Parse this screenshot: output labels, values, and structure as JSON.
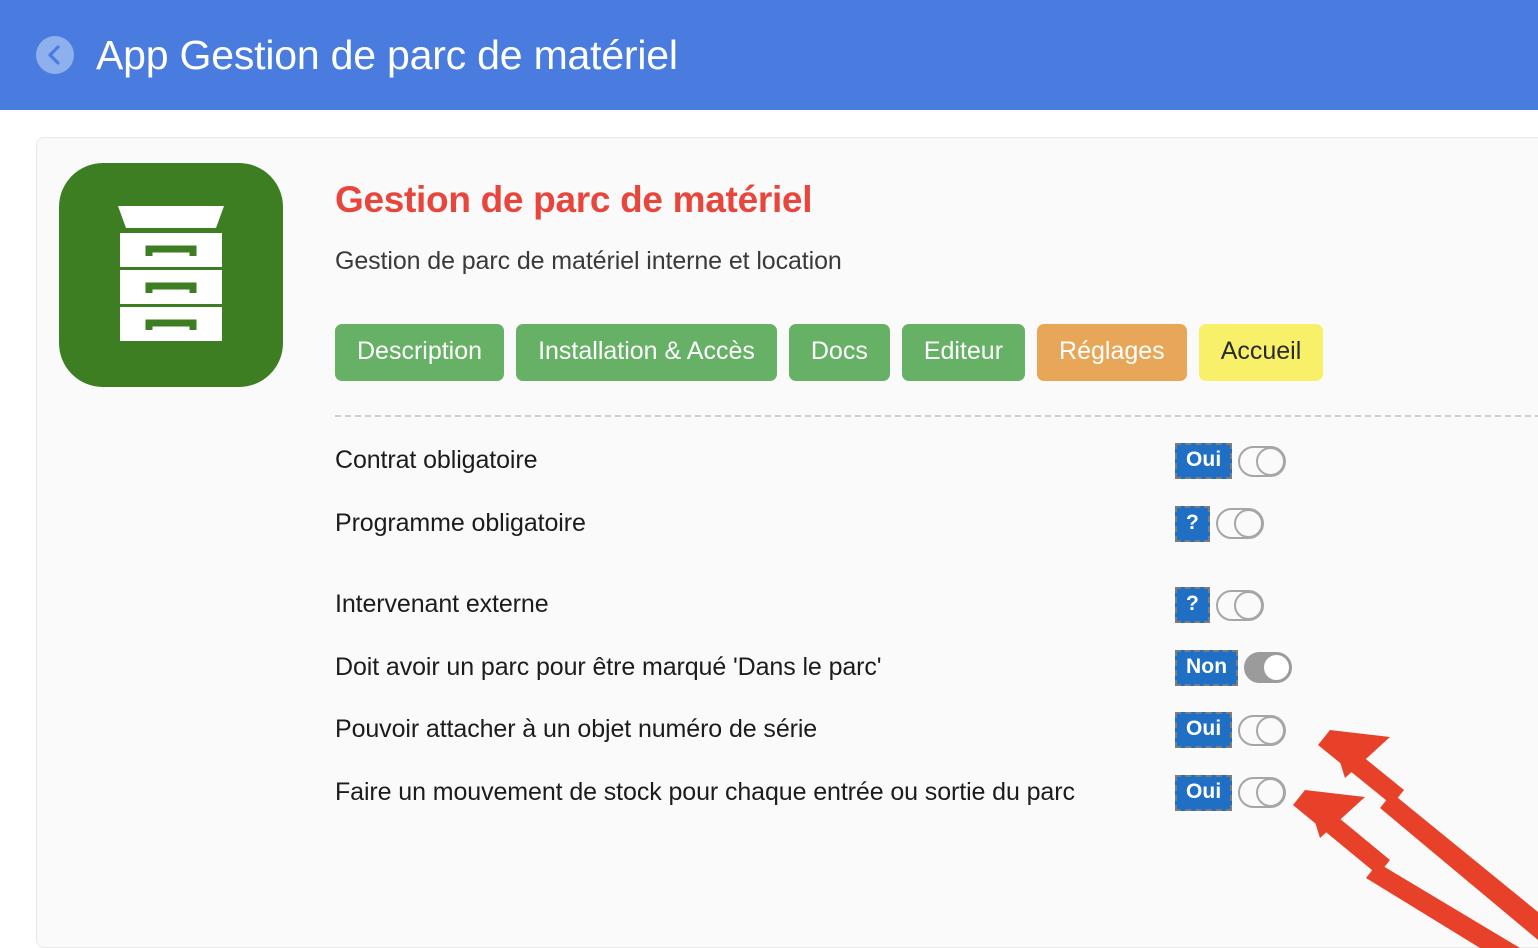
{
  "header": {
    "title": "App Gestion de parc de matériel",
    "back_icon": "chevron-left-circle-icon",
    "bg_color": "#4a7ce0"
  },
  "app": {
    "icon": "file-cabinet-icon",
    "icon_bg_color": "#3d7e22",
    "title": "Gestion de parc de matériel",
    "title_color": "#e8463c",
    "subtitle": "Gestion de parc de matériel interne et location"
  },
  "tabs": [
    {
      "label": "Description",
      "style": "green"
    },
    {
      "label": "Installation & Accès",
      "style": "green"
    },
    {
      "label": "Docs",
      "style": "green"
    },
    {
      "label": "Editeur",
      "style": "green"
    },
    {
      "label": "Réglages",
      "style": "orange"
    },
    {
      "label": "Accueil",
      "style": "yellow"
    }
  ],
  "tab_colors": {
    "green": "#66b166",
    "orange": "#e8a758",
    "yellow": "#f9f06a"
  },
  "settings": [
    {
      "label": "Contrat obligatoire",
      "badge": "Oui",
      "toggle": "off"
    },
    {
      "label": "Programme obligatoire",
      "badge": "?",
      "toggle": "off"
    },
    {
      "label": "Intervenant externe",
      "badge": "?",
      "toggle": "off"
    },
    {
      "label": "Doit avoir un parc pour être marqué 'Dans le parc'",
      "badge": "Non",
      "toggle": "on"
    },
    {
      "label": "Pouvoir attacher à un objet numéro de série",
      "badge": "Oui",
      "toggle": "off"
    },
    {
      "label": "Faire un mouvement de stock pour chaque entrée ou sortie du parc",
      "badge": "Oui",
      "toggle": "off"
    }
  ],
  "annotations": {
    "arrow_color": "#e8412a",
    "arrows": [
      {
        "name": "arrow-to-serial-toggle"
      },
      {
        "name": "arrow-to-stock-toggle"
      }
    ]
  }
}
